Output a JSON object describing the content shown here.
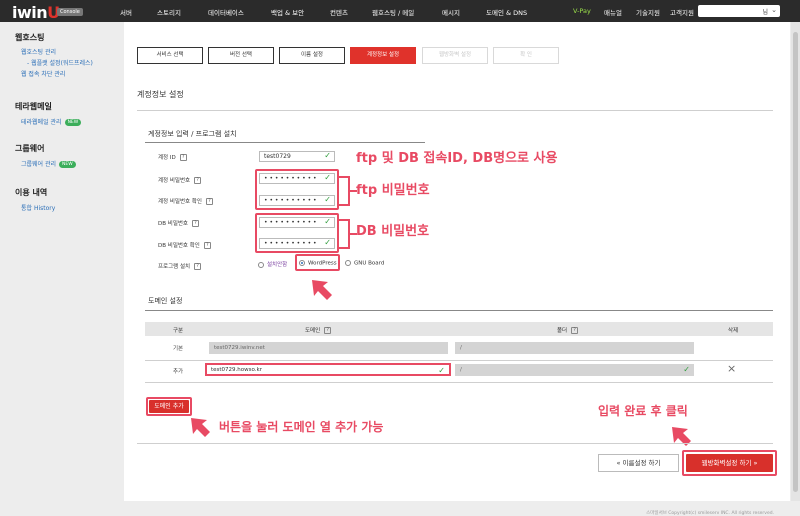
{
  "header": {
    "logo": "iwin",
    "logo_u": "U",
    "logo_badge": "Console",
    "nav": [
      "서버",
      "스토리지",
      "데이터베이스",
      "백업 & 보안",
      "컨텐츠",
      "웹호스팅 / 메일",
      "메시지",
      "도메인 & DNS"
    ],
    "vpay": "V-Pay",
    "links": [
      "매뉴얼",
      "기술지원",
      "고객지원"
    ],
    "search_value": "님"
  },
  "sidebar": {
    "groups": [
      {
        "title": "웹호스팅",
        "items": [
          "웹호스팅 관리",
          "- 웹플랫 설정(워드프레스)",
          "웹 접속 차단 관리"
        ]
      },
      {
        "title": "테라웹메일",
        "items": [
          "테라웹메일 관리"
        ],
        "badge": "NEW"
      },
      {
        "title": "그룹웨어",
        "items": [
          "그룹웨어 관리"
        ],
        "badge": "NEW"
      },
      {
        "title": "이용 내역",
        "items": [
          "통합 History"
        ]
      }
    ]
  },
  "steps": [
    "서비스 선택",
    "버전 선택",
    "이름 설정",
    "계정정보 설정",
    "웹방화벽 설정",
    "확 인"
  ],
  "account": {
    "title": "계정정보 설정",
    "subtitle": "계정정보 입력 / 프로그램 설치",
    "fields": [
      {
        "label": "계정 ID",
        "value": "test0729"
      },
      {
        "label": "계정 비밀번호",
        "value": "• • • • • • • • • •"
      },
      {
        "label": "계정 비밀번호 확인",
        "value": "• • • • • • • • • •"
      },
      {
        "label": "DB 비밀번호",
        "value": "• • • • • • • • • •"
      },
      {
        "label": "DB 비밀번호 확인",
        "value": "• • • • • • • • • •"
      }
    ],
    "program_label": "프로그램 설치",
    "program_options": [
      "설치안함",
      "WordPress",
      "GNU Board"
    ],
    "program_selected": "WordPress"
  },
  "domain": {
    "title": "도메인 설정",
    "headers": [
      "구분",
      "도메인",
      "폴더",
      "삭제"
    ],
    "rows": [
      {
        "type": "기본",
        "domain": "test0729.iwinv.net",
        "folder": "/"
      },
      {
        "type": "추가",
        "domain": "test0729.howso.kr",
        "folder": "/"
      }
    ],
    "add_button": "도메인 추가"
  },
  "annotations": {
    "ftp_db": "ftp 및 DB 접속ID, DB명으로 사용",
    "ftp_pw": "ftp 비밀번호",
    "db_pw": "DB 비밀번호",
    "add_domain": "버튼을 눌러 도메인 열 추가 가능",
    "click": "입력 완료 후 클릭"
  },
  "buttons": {
    "prev": "« 이름설정 하기",
    "next": "웹방화벽설정 하기 »"
  },
  "footer": "스마일서브 Copyright(c) smileserv INC. All rights reserved."
}
